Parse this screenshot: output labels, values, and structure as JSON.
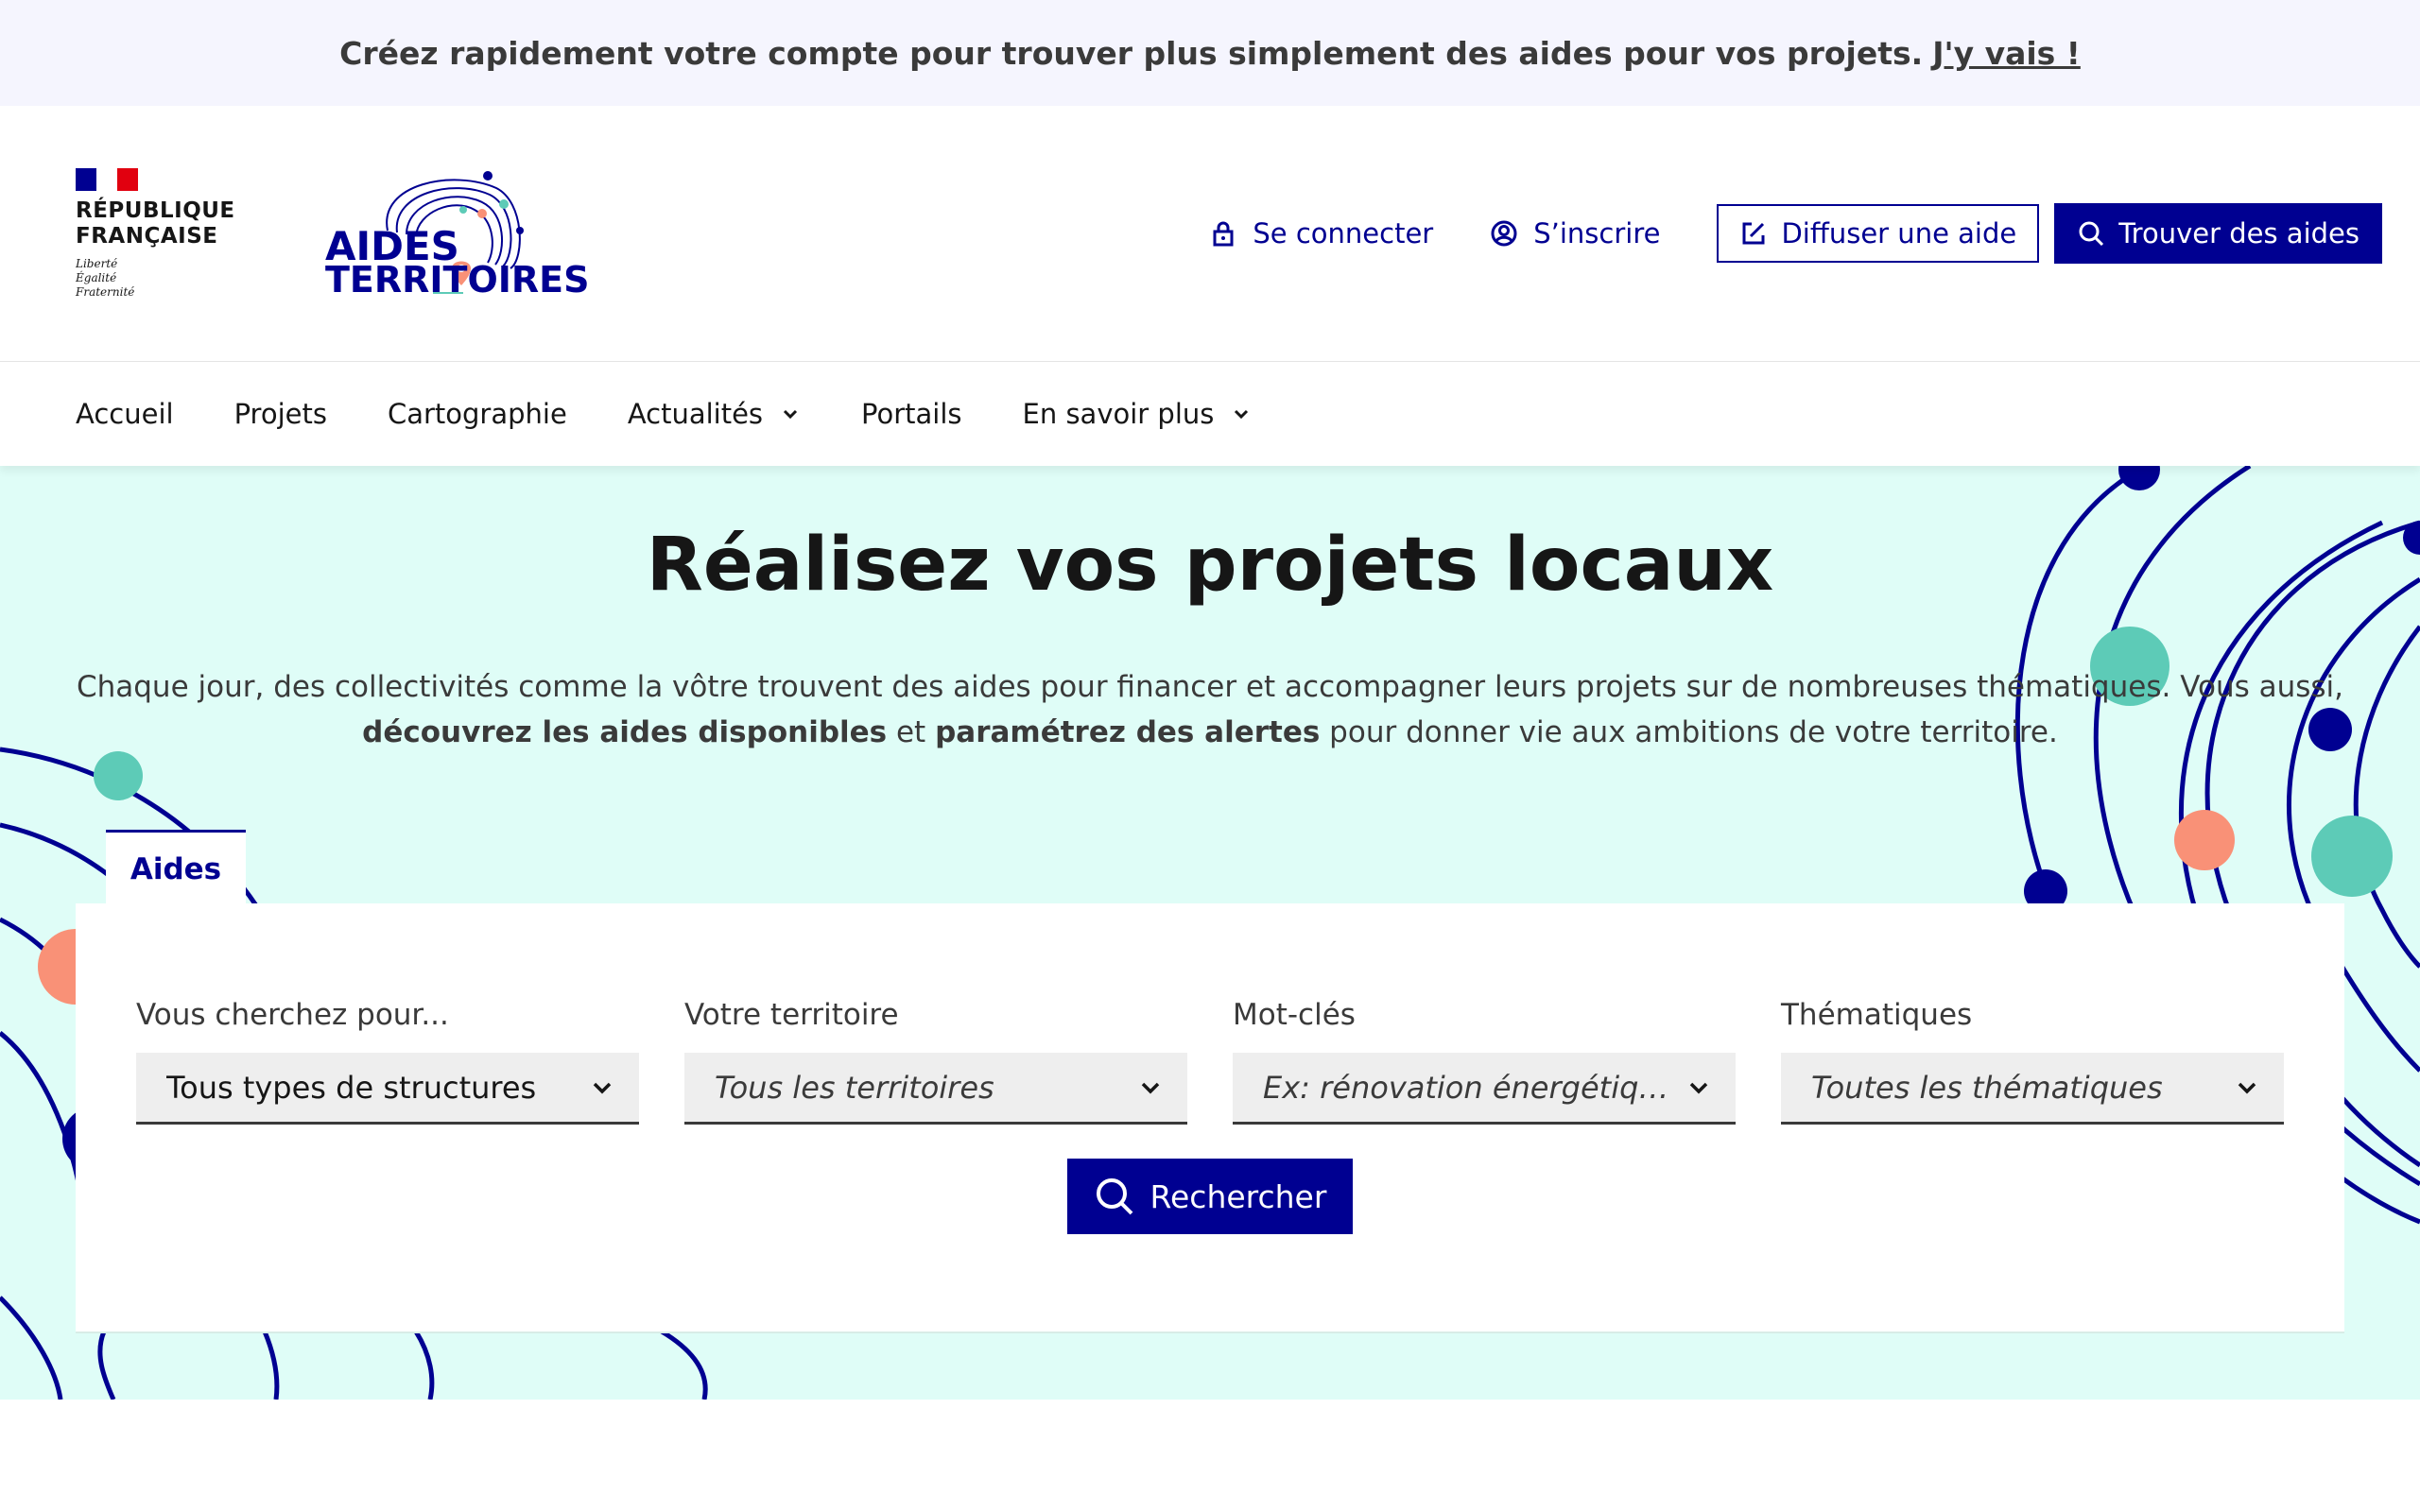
{
  "notice": {
    "text": "Créez rapidement votre compte pour trouver plus simplement des aides pour vos projets.",
    "link": "J'y vais !"
  },
  "header": {
    "republic": {
      "line1": "RÉPUBLIQUE",
      "line2": "FRANÇAISE",
      "motto": [
        "Liberté",
        "Égalité",
        "Fraternité"
      ]
    },
    "logo": {
      "line1": "AIDES",
      "line2": "TERRITOIRES"
    },
    "links": {
      "login": "Se connecter",
      "signup": "S’inscrire",
      "publish": "Diffuser une aide",
      "find": "Trouver des aides"
    }
  },
  "nav": {
    "items": [
      "Accueil",
      "Projets",
      "Cartographie",
      "Actualités",
      "Portails",
      "En savoir plus"
    ]
  },
  "hero": {
    "title": "Réalisez vos projets locaux",
    "lead_1": "Chaque jour, des collectivités comme la vôtre trouvent des aides pour financer et accompagner leurs projets sur de nombreuses thématiques. Vous aussi,",
    "lead_b1": "découvrez les aides disponibles",
    "lead_and": "et",
    "lead_b2": "paramétrez des alertes",
    "lead_2": "pour donner vie aux ambitions de votre territoire."
  },
  "search": {
    "tab": "Aides",
    "fields": [
      {
        "label": "Vous cherchez pour...",
        "value": "Tous types de structures"
      },
      {
        "label": "Votre territoire",
        "value": "Tous les territoires"
      },
      {
        "label": "Mot-clés",
        "value": "Ex: rénovation énergétique, vélo, tiers lieu, etc."
      },
      {
        "label": "Thématiques",
        "value": "Toutes les thématiques"
      }
    ],
    "button": "Rechercher"
  },
  "colors": {
    "primary": "#000091",
    "hero_bg": "#dffdf7",
    "accent_teal": "#5dcbb7",
    "accent_coral": "#f99177"
  }
}
